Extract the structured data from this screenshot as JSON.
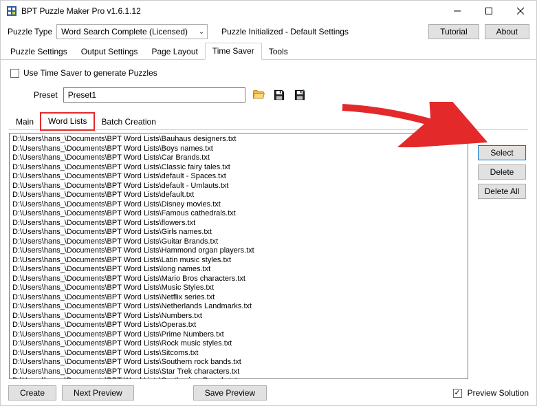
{
  "window": {
    "title": "BPT Puzzle Maker Pro v1.6.1.12"
  },
  "top": {
    "puzzle_type_label": "Puzzle Type",
    "puzzle_type_value": "Word Search Complete (Licensed)",
    "status": "Puzzle Initialized - Default Settings",
    "tutorial_btn": "Tutorial",
    "about_btn": "About"
  },
  "tabs": {
    "items": [
      {
        "label": "Puzzle Settings"
      },
      {
        "label": "Output Settings"
      },
      {
        "label": "Page Layout"
      },
      {
        "label": "Time Saver"
      },
      {
        "label": "Tools"
      }
    ],
    "active_index": 3
  },
  "time_saver": {
    "checkbox_label": "Use Time Saver to generate Puzzles",
    "preset_label": "Preset",
    "preset_value": "Preset1"
  },
  "subtabs": {
    "items": [
      {
        "label": "Main"
      },
      {
        "label": "Word Lists"
      },
      {
        "label": "Batch Creation"
      }
    ],
    "active_index": 1
  },
  "word_lists": [
    "D:\\Users\\hans_\\Documents\\BPT Word Lists\\Bauhaus designers.txt",
    "D:\\Users\\hans_\\Documents\\BPT Word Lists\\Boys names.txt",
    "D:\\Users\\hans_\\Documents\\BPT Word Lists\\Car Brands.txt",
    "D:\\Users\\hans_\\Documents\\BPT Word Lists\\Classic fairy tales.txt",
    "D:\\Users\\hans_\\Documents\\BPT Word Lists\\default - Spaces.txt",
    "D:\\Users\\hans_\\Documents\\BPT Word Lists\\default - Umlauts.txt",
    "D:\\Users\\hans_\\Documents\\BPT Word Lists\\default.txt",
    "D:\\Users\\hans_\\Documents\\BPT Word Lists\\Disney movies.txt",
    "D:\\Users\\hans_\\Documents\\BPT Word Lists\\Famous cathedrals.txt",
    "D:\\Users\\hans_\\Documents\\BPT Word Lists\\flowers.txt",
    "D:\\Users\\hans_\\Documents\\BPT Word Lists\\Girls names.txt",
    "D:\\Users\\hans_\\Documents\\BPT Word Lists\\Guitar Brands.txt",
    "D:\\Users\\hans_\\Documents\\BPT Word Lists\\Hammond organ players.txt",
    "D:\\Users\\hans_\\Documents\\BPT Word Lists\\Latin music styles.txt",
    "D:\\Users\\hans_\\Documents\\BPT Word Lists\\long names.txt",
    "D:\\Users\\hans_\\Documents\\BPT Word Lists\\Mario Bros characters.txt",
    "D:\\Users\\hans_\\Documents\\BPT Word Lists\\Music Styles.txt",
    "D:\\Users\\hans_\\Documents\\BPT Word Lists\\Netflix series.txt",
    "D:\\Users\\hans_\\Documents\\BPT Word Lists\\Netherlands Landmarks.txt",
    "D:\\Users\\hans_\\Documents\\BPT Word Lists\\Numbers.txt",
    "D:\\Users\\hans_\\Documents\\BPT Word Lists\\Operas.txt",
    "D:\\Users\\hans_\\Documents\\BPT Word Lists\\Prime Numbers.txt",
    "D:\\Users\\hans_\\Documents\\BPT Word Lists\\Rock music styles.txt",
    "D:\\Users\\hans_\\Documents\\BPT Word Lists\\Sitcoms.txt",
    "D:\\Users\\hans_\\Documents\\BPT Word Lists\\Southern rock bands.txt",
    "D:\\Users\\hans_\\Documents\\BPT Word Lists\\Star Trek characters.txt",
    "D:\\Users\\hans_\\Documents\\BPT Word Lists\\Synthesizer Brands.txt"
  ],
  "side_buttons": {
    "select": "Select",
    "delete": "Delete",
    "delete_all": "Delete All"
  },
  "footer": {
    "create": "Create",
    "next_preview": "Next Preview",
    "save_preview": "Save Preview",
    "preview_solution": "Preview Solution"
  }
}
